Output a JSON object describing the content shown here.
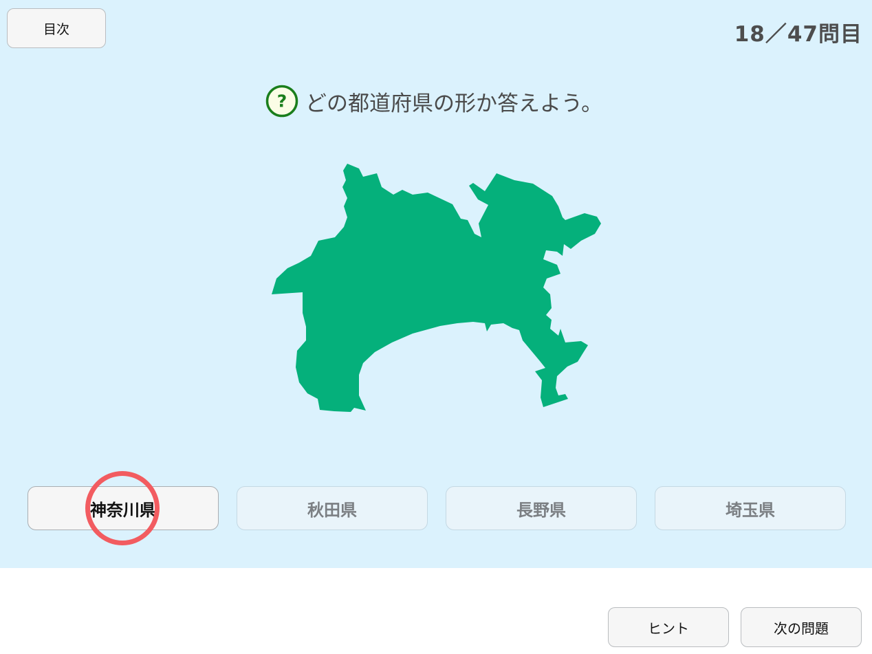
{
  "header": {
    "toc_label": "目次",
    "progress": "18／47問目"
  },
  "question": {
    "icon": "question-circle-icon",
    "icon_glyph": "?",
    "text": "どの都道府県の形か答えよう。"
  },
  "map": {
    "icon": "prefecture-shape-kanagawa",
    "fill_color": "#05b07b"
  },
  "choices": [
    {
      "label": "神奈川県",
      "state": "selected"
    },
    {
      "label": "秋田県",
      "state": "dim"
    },
    {
      "label": "長野県",
      "state": "dim"
    },
    {
      "label": "埼玉県",
      "state": "dim"
    }
  ],
  "footer": {
    "hint_label": "ヒント",
    "next_label": "次の問題"
  },
  "colors": {
    "panel_bg": "#dbf2fd",
    "marker": "#f25c60",
    "icon_green": "#1a7e1c"
  }
}
